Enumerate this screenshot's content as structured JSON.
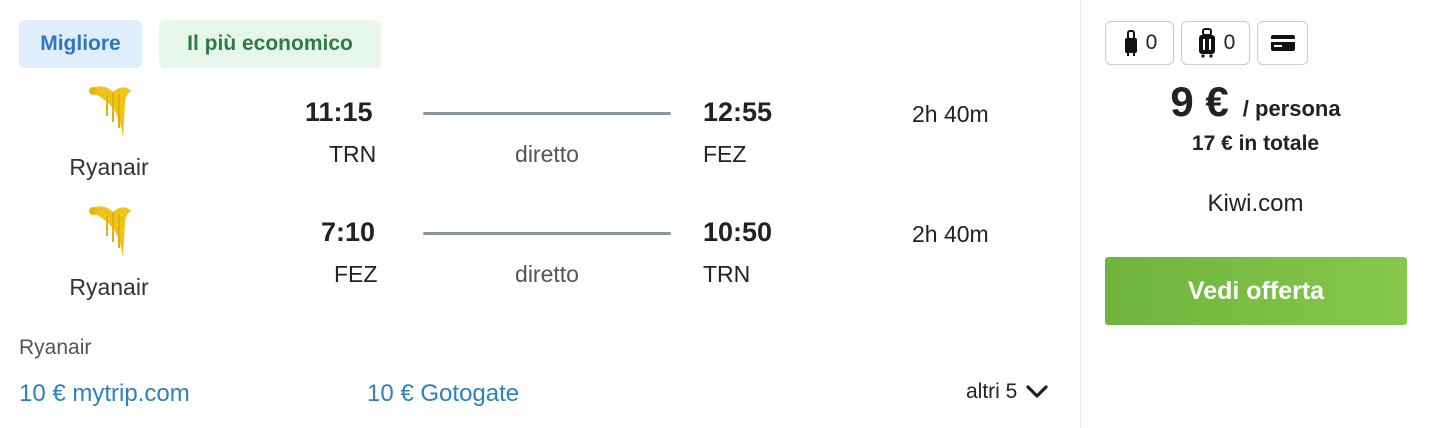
{
  "badges": {
    "best": "Migliore",
    "cheapest": "Il più economico"
  },
  "colors": {
    "badge_best_text": "#2f75c5",
    "badge_cheap_text": "#2f7a45",
    "cta": "#7bbf44",
    "link": "#2f7fc4",
    "logo": "#f0c419"
  },
  "legs": [
    {
      "airline": "Ryanair",
      "logo": "ryanair-harp-icon",
      "dep_time": "11:15",
      "dep_code": "TRN",
      "stops": "diretto",
      "arr_time": "12:55",
      "arr_code": "FEZ",
      "duration": "2h 40m"
    },
    {
      "airline": "Ryanair",
      "logo": "ryanair-harp-icon",
      "dep_time": "7:10",
      "dep_code": "FEZ",
      "stops": "diretto",
      "arr_time": "10:50",
      "arr_code": "TRN",
      "duration": "2h 40m"
    }
  ],
  "footer": {
    "airline": "Ryanair",
    "alternatives": [
      "10 € mytrip.com",
      "10 € Gotogate"
    ],
    "more": "altri 5"
  },
  "baggage": {
    "personal_item_count": "0",
    "cabin_bag_count": "0",
    "icons": [
      "personal-bag-icon",
      "cabin-bag-icon",
      "card-icon"
    ]
  },
  "price": {
    "amount": "9 €",
    "per": "/ persona",
    "total": "17 € in totale"
  },
  "provider": "Kiwi.com",
  "cta_label": "Vedi offerta"
}
